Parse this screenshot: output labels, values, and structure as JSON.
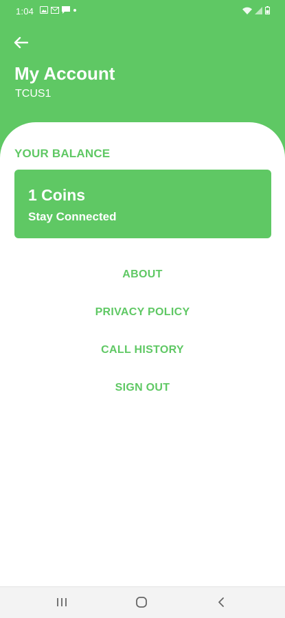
{
  "status_bar": {
    "time": "1:04",
    "left_icons": [
      "image-icon",
      "mail-icon",
      "message-icon",
      "dot-icon"
    ],
    "right_icons": [
      "wifi-icon",
      "signal-icon",
      "battery-icon"
    ]
  },
  "header": {
    "back_icon": "arrow-left-icon",
    "title": "My Account",
    "subtitle": "TCUS1"
  },
  "balance": {
    "label": "YOUR BALANCE",
    "amount": "1 Coins",
    "note": "Stay Connected"
  },
  "menu": {
    "items": [
      {
        "label": "ABOUT"
      },
      {
        "label": "PRIVACY POLICY"
      },
      {
        "label": "CALL HISTORY"
      },
      {
        "label": "SIGN OUT"
      }
    ]
  },
  "nav_bar": {
    "buttons": [
      "recents-icon",
      "home-icon",
      "back-icon"
    ]
  },
  "colors": {
    "accent": "#5fc864",
    "background": "#ffffff",
    "nav_bar": "#f3f3f3"
  }
}
